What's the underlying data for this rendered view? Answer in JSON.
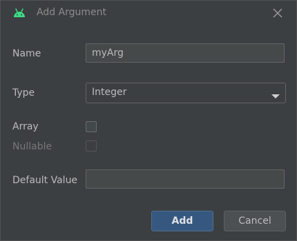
{
  "window": {
    "title": "Add Argument",
    "icon": "android-icon",
    "close_icon": "close-icon"
  },
  "form": {
    "name_label": "Name",
    "name_value": "myArg",
    "type_label": "Type",
    "type_value": "Integer",
    "array_label": "Array",
    "array_checked": false,
    "nullable_label": "Nullable",
    "nullable_checked": false,
    "nullable_enabled": false,
    "default_value_label": "Default Value",
    "default_value": ""
  },
  "buttons": {
    "add_label": "Add",
    "cancel_label": "Cancel"
  },
  "colors": {
    "android_green": "#3ddc84",
    "primary_button": "#365880",
    "dialog_bg": "#3c3f41"
  }
}
